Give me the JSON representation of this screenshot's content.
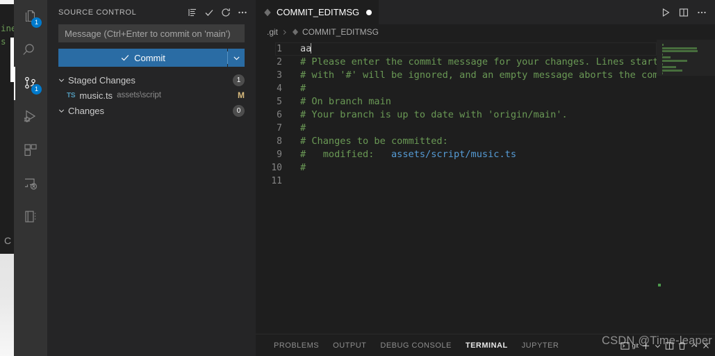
{
  "background_windows": {
    "code_fragments": [
      "ines",
      "s t"
    ],
    "char": "C"
  },
  "activitybar": {
    "items": [
      {
        "name": "explorer",
        "icon": "files-icon",
        "badge": "1",
        "active": false
      },
      {
        "name": "search",
        "icon": "search-icon",
        "badge": "",
        "active": false
      },
      {
        "name": "source-control",
        "icon": "source-control-icon",
        "badge": "1",
        "active": true
      },
      {
        "name": "run-debug",
        "icon": "run-and-debug-icon",
        "badge": "",
        "active": false
      },
      {
        "name": "extensions",
        "icon": "extensions-icon",
        "badge": "",
        "active": false
      },
      {
        "name": "remote-explorer",
        "icon": "remote-explorer-icon",
        "badge": "",
        "active": false
      },
      {
        "name": "jupyter-notebook",
        "icon": "notebook-icon",
        "badge": "",
        "active": false
      }
    ]
  },
  "sidebar": {
    "title": "SOURCE CONTROL",
    "actions": [
      {
        "name": "view-as-list",
        "icon": "list-view-icon"
      },
      {
        "name": "commit",
        "icon": "check-icon"
      },
      {
        "name": "refresh",
        "icon": "refresh-icon"
      },
      {
        "name": "more-actions",
        "icon": "ellipsis-icon"
      }
    ],
    "commit_input": {
      "placeholder": "Message (Ctrl+Enter to commit on 'main')",
      "value": ""
    },
    "commit_button": {
      "label": "Commit",
      "icon": "check-icon",
      "dropdown_icon": "chevron-down-icon",
      "color": "#2a6ca4"
    },
    "groups": [
      {
        "label": "Staged Changes",
        "count": "1",
        "expanded": true,
        "files": [
          {
            "icon_label": "TS",
            "name": "music.ts",
            "path": "assets\\script",
            "status": "M",
            "status_color": "#d7ba7d"
          }
        ]
      },
      {
        "label": "Changes",
        "count": "0",
        "expanded": true,
        "files": []
      }
    ]
  },
  "editor": {
    "tab": {
      "label": "COMMIT_EDITMSG",
      "icon": "git-commit-file-icon",
      "dirty": true
    },
    "tab_actions": [
      {
        "name": "run-file",
        "icon": "play-icon"
      },
      {
        "name": "split-editor",
        "icon": "split-editor-icon"
      },
      {
        "name": "more-actions",
        "icon": "ellipsis-icon"
      }
    ],
    "breadcrumbs": [
      {
        "label": ".git",
        "icon": ""
      },
      {
        "label": "COMMIT_EDITMSG",
        "icon": "git-commit-file-icon"
      }
    ],
    "cursor_line": 1,
    "lines": [
      {
        "num": "1",
        "segments": [
          {
            "text": "aa",
            "kind": "plain"
          }
        ],
        "caret": true
      },
      {
        "num": "2",
        "segments": [
          {
            "text": "# Please enter the commit message for your changes. Lines starting",
            "kind": "comment"
          }
        ]
      },
      {
        "num": "3",
        "segments": [
          {
            "text": "# with '#' will be ignored, and an empty message aborts the commit.",
            "kind": "comment"
          }
        ]
      },
      {
        "num": "4",
        "segments": [
          {
            "text": "#",
            "kind": "comment"
          }
        ]
      },
      {
        "num": "5",
        "segments": [
          {
            "text": "# On branch main",
            "kind": "comment"
          }
        ]
      },
      {
        "num": "6",
        "segments": [
          {
            "text": "# Your branch is up to date with 'origin/main'.",
            "kind": "comment"
          }
        ]
      },
      {
        "num": "7",
        "segments": [
          {
            "text": "#",
            "kind": "comment"
          }
        ]
      },
      {
        "num": "8",
        "segments": [
          {
            "text": "# Changes to be committed:",
            "kind": "comment"
          }
        ]
      },
      {
        "num": "9",
        "segments": [
          {
            "text": "#   modified:   ",
            "kind": "comment"
          },
          {
            "text": "assets/script/music.ts",
            "kind": "path"
          }
        ]
      },
      {
        "num": "10",
        "segments": [
          {
            "text": "#",
            "kind": "comment"
          }
        ]
      },
      {
        "num": "11",
        "segments": [
          {
            "text": "",
            "kind": "plain"
          }
        ]
      }
    ],
    "minimap_enabled": true
  },
  "panel": {
    "tabs": [
      {
        "label": "PROBLEMS",
        "active": false
      },
      {
        "label": "OUTPUT",
        "active": false
      },
      {
        "label": "DEBUG CONSOLE",
        "active": false
      },
      {
        "label": "TERMINAL",
        "active": true
      },
      {
        "label": "JUPYTER",
        "active": false
      }
    ],
    "terminal_name": "git",
    "actions": [
      {
        "name": "terminal-shell-selector",
        "icon": "terminal-icon",
        "label": "git"
      },
      {
        "name": "new-terminal",
        "icon": "plus-icon",
        "label": ""
      },
      {
        "name": "terminal-profile-dropdown",
        "icon": "chevron-down-icon",
        "label": ""
      },
      {
        "name": "split-terminal",
        "icon": "split-icon",
        "label": ""
      },
      {
        "name": "kill-terminal",
        "icon": "trash-icon",
        "label": ""
      },
      {
        "name": "maximize-panel",
        "icon": "chevron-up-icon",
        "label": ""
      },
      {
        "name": "close-panel",
        "icon": "close-icon",
        "label": ""
      }
    ]
  },
  "watermark": {
    "text": "CSDN @Time-leaper"
  },
  "colors": {
    "accent": "#007acc",
    "commit_button": "#2a6ca4",
    "sidebar_bg": "#252526",
    "activitybar_bg": "#333333",
    "editor_bg": "#1e1e1e",
    "comment": "#6a9955",
    "path": "#569cd6",
    "modified": "#d7ba7d"
  }
}
